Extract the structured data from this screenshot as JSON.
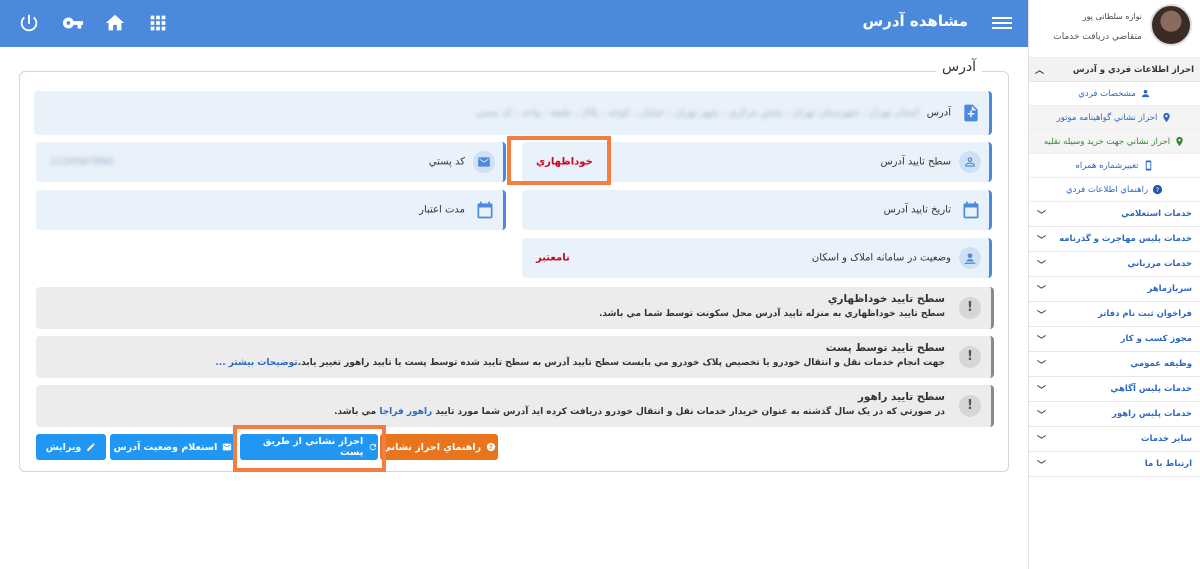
{
  "header": {
    "title": "مشاهده آدرس"
  },
  "sidebar": {
    "profile": {
      "name": "نوازه سلطانی پور",
      "role": "متقاضي دريافت خدمات"
    },
    "expanded_section": "احراز اطلاعات فردي و آدرس",
    "sub_items": [
      "مشخصات فردي",
      "احراز نشاني گواهينامه موتور",
      "احراز نشاني جهت خريد وسيله نقليه",
      "تغييرشماره همراه",
      "راهنماي اطلاعات فردي"
    ],
    "categories": [
      "خدمات استعلامي",
      "خدمات پليس مهاجرت و گذرنامه",
      "خدمات مرزباني",
      "سربازماهر",
      "فراخوان ثبت نام دفاتر",
      "مجوز کسب و کار",
      "وظيفه عمومي",
      "خدمات پليس آگاهي",
      "خدمات پليس راهور",
      "ساير خدمات",
      "ارتباط با ما"
    ]
  },
  "card": {
    "title": "آدرس",
    "address_label": "آدرس",
    "address_value": "استان تهران ، شهرستان تهران ، بخش مرکزی ، شهر تهران ، خیابان ، کوچه ، پلاک ، طبقه ، واحد ، کد پستی",
    "verify_level_label": "سطح تاييد آدرس",
    "verify_level_value": "خوداظهاري",
    "postal_code_label": "کد پستي",
    "postal_code_value": "1234567890",
    "verify_date_label": "تاريخ تاييد آدرس",
    "validity_label": "مدت اعتبار",
    "registry_status_label": "وضعيت در سامانه املاک و اسکان",
    "registry_status_value": "نامعتبر"
  },
  "notes": [
    {
      "title": "سطح تاييد خوداظهاري",
      "text": "سطح تاييد خوداظهاري به منزله تاييد آدرس محل سکونت توسط شما مي باشد."
    },
    {
      "title": "سطح تاييد توسط پست",
      "text": "جهت انجام خدمات نقل و انتقال خودرو يا تخصيص پلاک خودرو مي بايست سطح تاييد آدرس به سطح تاييد شده توسط پست يا تاييد راهور تغيير يابد.",
      "link": "توضيحات بيشتر ..."
    },
    {
      "title": "سطح تاييد راهور",
      "text_before": "در صورتي که در يک سال گذشته به عنوان خريدار خدمات نقل و انتقال خودرو دريافت کرده ايد آدرس شما مورد تاييد",
      "link": "راهور فراجا",
      "text_after": "مي باشد."
    }
  ],
  "buttons": {
    "guide": "راهنماي احراز نشاني",
    "post_verify": "احراز نشاني از طريق پست",
    "inquiry": "استعلام وضعيت آدرس",
    "edit": "ويرايش"
  },
  "colors": {
    "header": "#4a89dc",
    "field_bg": "#e9f1fb",
    "highlight": "#f47e42",
    "danger": "#d0021b",
    "button_blue": "#2196f3",
    "button_orange": "#e8741d"
  }
}
